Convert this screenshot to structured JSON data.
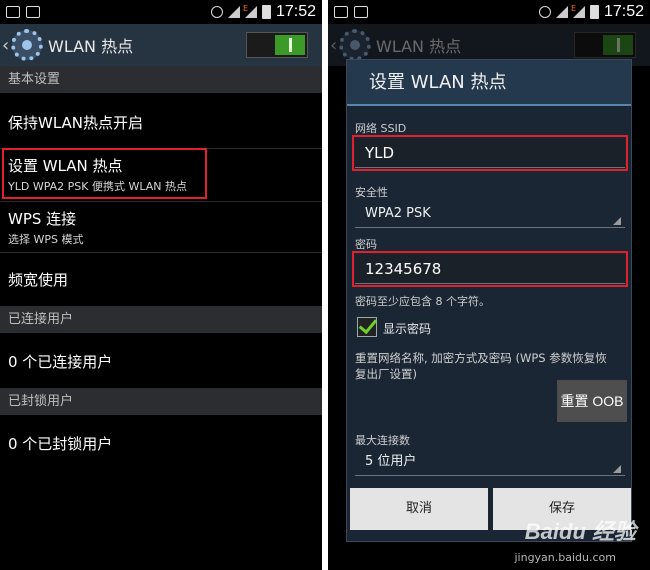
{
  "status_bar": {
    "time": "17:52"
  },
  "action_bar": {
    "title": "WLAN 热点",
    "toggle_on": true
  },
  "left": {
    "sections": [
      {
        "header": "基本设置"
      },
      {
        "header": "已连接用户"
      },
      {
        "header": "已封锁用户"
      }
    ],
    "items": [
      {
        "title": "保持WLAN热点开启"
      },
      {
        "title": "设置 WLAN 热点",
        "subtitle": "YLD WPA2 PSK 便携式 WLAN 热点"
      },
      {
        "title": "WPS 连接",
        "subtitle": "选择 WPS 模式"
      },
      {
        "title": "频宽使用"
      },
      {
        "title": "0 个已连接用户"
      },
      {
        "title": "0 个已封锁用户"
      }
    ]
  },
  "dialog": {
    "title": "设置 WLAN 热点",
    "ssid_label": "网络 SSID",
    "ssid_value": "YLD",
    "security_label": "安全性",
    "security_value": "WPA2 PSK",
    "password_label": "密码",
    "password_value": "12345678",
    "password_hint": "密码至少应包含 8 个字符。",
    "show_password_label": "显示密码",
    "show_password_checked": true,
    "reset_text_line1": "重置网络名称, 加密方式及密码 (WPS 参数恢复恢",
    "reset_text_line2": "复出厂设置)",
    "reset_button": "重置 OOB",
    "max_conn_label": "最大连接数",
    "max_conn_value": "5 位用户",
    "cancel_button": "取消",
    "save_button": "保存"
  },
  "watermark": {
    "logo": "Baidu 经验",
    "url": "jingyan.baidu.com"
  },
  "colors": {
    "accent_green": "#3c9a28",
    "highlight_red": "#e0202a",
    "action_bar_bg": "#263340"
  }
}
